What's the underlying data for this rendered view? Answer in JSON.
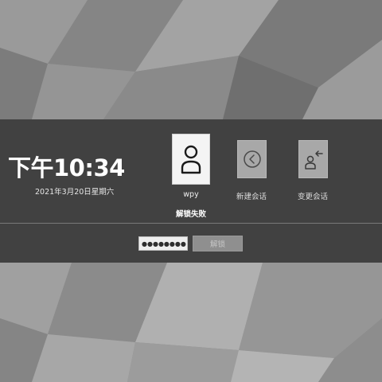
{
  "clock": {
    "time": "下午10:34",
    "date": "2021年3月20日星期六"
  },
  "sessions": {
    "user": {
      "label": "wpy",
      "icon": "user-avatar-icon"
    },
    "new_session": {
      "label": "新建会话",
      "icon": "chevron-left-circle-icon"
    },
    "switch_session": {
      "label": "变更会话",
      "icon": "switch-user-icon"
    }
  },
  "status": {
    "message": "解锁失败"
  },
  "login": {
    "password_value": "●●●●●●●●",
    "unlock_label": "解锁"
  },
  "colors": {
    "band": "#343434",
    "tile_active": "#f4f4f4",
    "tile_inactive": "#a8a8a8",
    "button": "#8f8f8f"
  }
}
